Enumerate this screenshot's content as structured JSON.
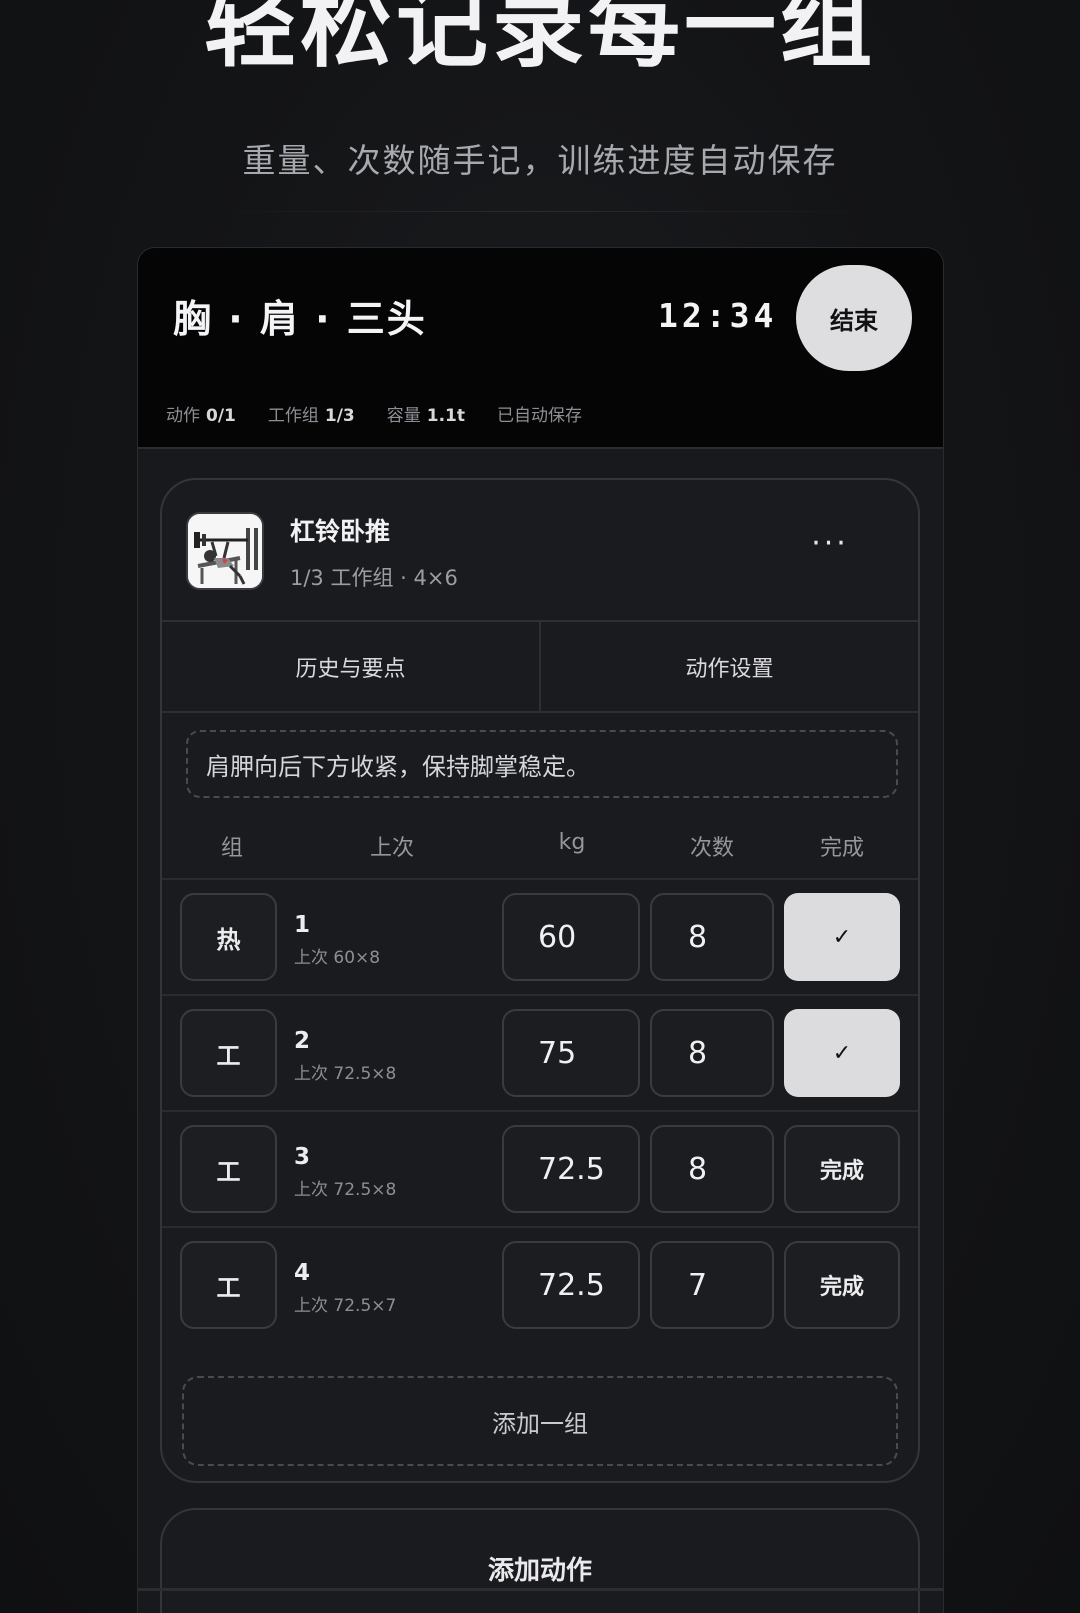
{
  "hero": {
    "title": "轻松记录每一组",
    "subtitle": "重量、次数随手记，训练进度自动保存"
  },
  "session": {
    "title": "胸 · 肩 · 三头",
    "timer": "12:34",
    "end_label": "结束",
    "stats": [
      {
        "label": "动作",
        "value": "0/1"
      },
      {
        "label": "工作组",
        "value": "1/3"
      },
      {
        "label": "容量",
        "value": "1.1t"
      },
      {
        "label": "已自动保存",
        "value": ""
      }
    ]
  },
  "exercise": {
    "name": "杠铃卧推",
    "meta": "1/3 工作组 · 4×6",
    "more_label": "···",
    "thumbnail_icon": "bench-press-illustration",
    "tabs": [
      "历史与要点",
      "动作设置"
    ],
    "note": "肩胛向后下方收紧，保持脚掌稳定。",
    "columns": [
      "组",
      "上次",
      "kg",
      "次数",
      "完成"
    ],
    "sets": [
      {
        "tag": "热",
        "number": "1",
        "previous": "上次 60×8",
        "kg": "60",
        "reps": "8",
        "done": true,
        "done_label": "✓"
      },
      {
        "tag": "工",
        "number": "2",
        "previous": "上次 72.5×8",
        "kg": "75",
        "reps": "8",
        "done": true,
        "done_label": "✓"
      },
      {
        "tag": "工",
        "number": "3",
        "previous": "上次 72.5×8",
        "kg": "72.5",
        "reps": "8",
        "done": false,
        "done_label": "完成"
      },
      {
        "tag": "工",
        "number": "4",
        "previous": "上次 72.5×7",
        "kg": "72.5",
        "reps": "7",
        "done": false,
        "done_label": "完成"
      }
    ],
    "add_set_label": "添加一组"
  },
  "add_exercise_label": "添加动作"
}
